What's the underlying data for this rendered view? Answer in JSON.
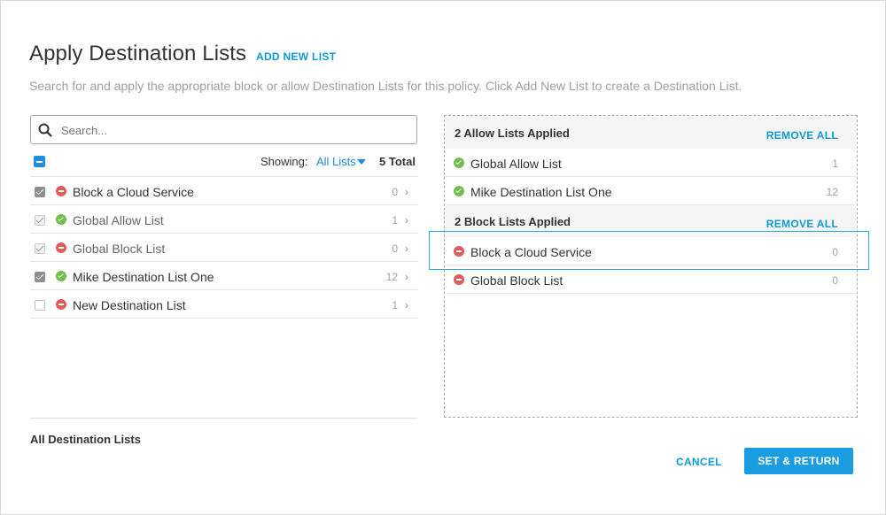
{
  "header": {
    "title": "Apply Destination Lists",
    "add_new_label": "ADD NEW LIST",
    "subtitle": "Search for and apply the appropriate block or allow Destination Lists for this policy. Click Add New List to create a Destination List."
  },
  "search": {
    "placeholder": "Search...",
    "value": ""
  },
  "filter": {
    "showing_label": "Showing:",
    "selected": "All Lists",
    "total": "5 Total"
  },
  "left_list": {
    "rows": [
      {
        "label": "Block a Cloud Service",
        "count": "0",
        "type": "block",
        "checked": true
      },
      {
        "label": "Global Allow List",
        "count": "1",
        "type": "allow",
        "checked": true
      },
      {
        "label": "Global Block List",
        "count": "0",
        "type": "block",
        "checked": true
      },
      {
        "label": "Mike Destination List One",
        "count": "12",
        "type": "allow",
        "checked": true
      },
      {
        "label": "New Destination List",
        "count": "1",
        "type": "block",
        "checked": false
      }
    ],
    "footer_label": "All Destination Lists"
  },
  "applied": {
    "allow_section": {
      "title": "2 Allow Lists Applied",
      "remove_label": "REMOVE ALL",
      "rows": [
        {
          "label": "Global Allow List",
          "count": "1"
        },
        {
          "label": "Mike Destination List One",
          "count": "12"
        }
      ]
    },
    "block_section": {
      "title": "2 Block Lists Applied",
      "remove_label": "REMOVE ALL",
      "rows": [
        {
          "label": "Block a Cloud Service",
          "count": "0"
        },
        {
          "label": "Global Block List",
          "count": "0"
        }
      ]
    }
  },
  "actions": {
    "cancel_label": "CANCEL",
    "submit_label": "SET & RETURN"
  },
  "colors": {
    "accent": "#0d9bd4",
    "primary_button": "#1b9de2",
    "allow": "#6cbf4a",
    "block": "#e05c5c"
  }
}
